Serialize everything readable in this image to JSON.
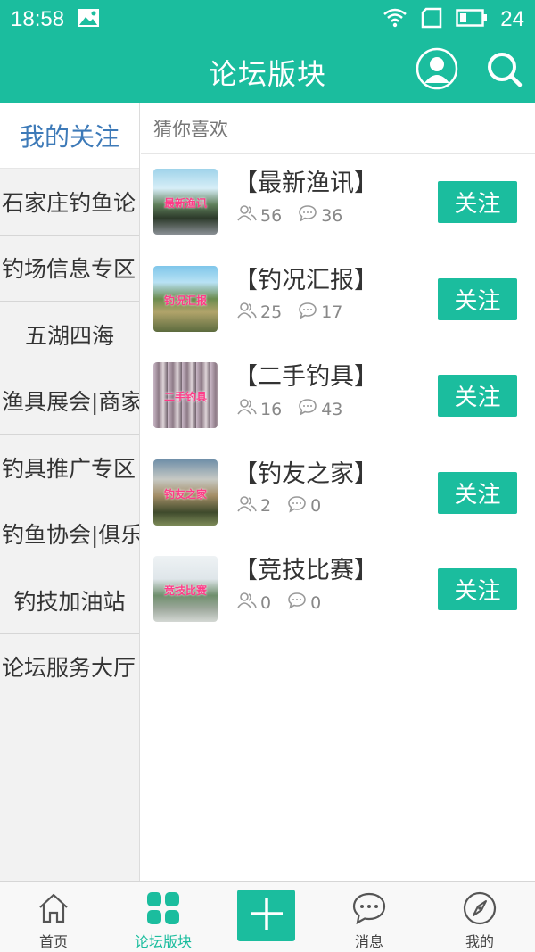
{
  "status_bar": {
    "time": "18:58",
    "battery": "24"
  },
  "header": {
    "title": "论坛版块"
  },
  "sidebar": {
    "items": [
      {
        "label": "我的关注"
      },
      {
        "label": "石家庄钓鱼论"
      },
      {
        "label": "钓场信息专区"
      },
      {
        "label": "五湖四海"
      },
      {
        "label": "渔具展会|商家"
      },
      {
        "label": "钓具推广专区"
      },
      {
        "label": "钓鱼协会|俱乐"
      },
      {
        "label": "钓技加油站"
      },
      {
        "label": "论坛服务大厅"
      }
    ]
  },
  "section": {
    "title": "猜你喜欢"
  },
  "forums": [
    {
      "name": "【最新渔讯】",
      "thumb_caption": "最新渔讯",
      "members": "56",
      "posts": "36",
      "follow_label": "关注"
    },
    {
      "name": "【钓况汇报】",
      "thumb_caption": "钓况汇报",
      "members": "25",
      "posts": "17",
      "follow_label": "关注"
    },
    {
      "name": "【二手钓具】",
      "thumb_caption": "二手钓具",
      "members": "16",
      "posts": "43",
      "follow_label": "关注"
    },
    {
      "name": "【钓友之家】",
      "thumb_caption": "钓友之家",
      "members": "2",
      "posts": "0",
      "follow_label": "关注"
    },
    {
      "name": "【竞技比赛】",
      "thumb_caption": "竞技比赛",
      "members": "0",
      "posts": "0",
      "follow_label": "关注"
    }
  ],
  "tabs": [
    {
      "label": "首页",
      "icon": "home-icon"
    },
    {
      "label": "论坛版块",
      "icon": "grid-icon"
    },
    {
      "label": "",
      "icon": "plus-icon"
    },
    {
      "label": "消息",
      "icon": "message-icon"
    },
    {
      "label": "我的",
      "icon": "compass-icon"
    }
  ],
  "colors": {
    "accent": "#1bbd9e",
    "sidebar_active_text": "#3d7ab8"
  }
}
